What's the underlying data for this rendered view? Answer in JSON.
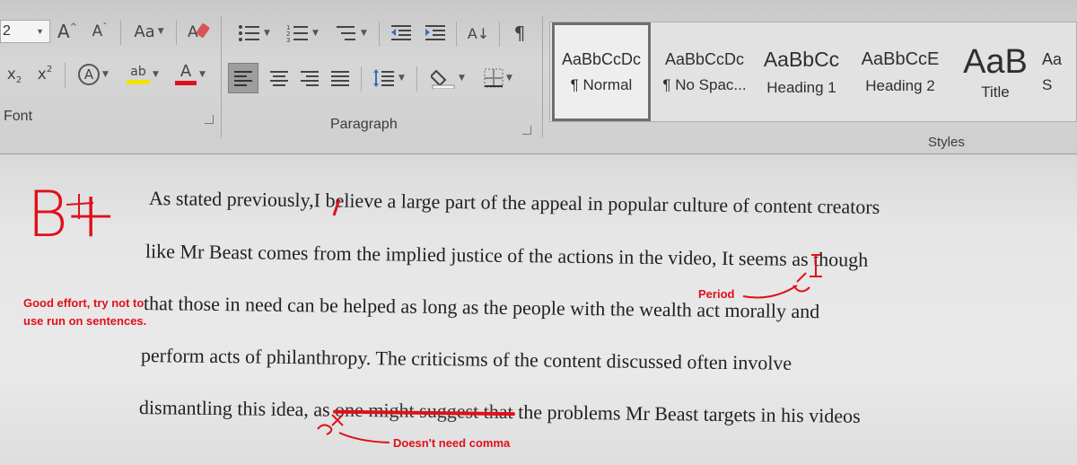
{
  "ribbon": {
    "font_size_value": "2",
    "groups": {
      "font_label": "Font",
      "paragraph_label": "Paragraph",
      "styles_label": "Styles"
    },
    "font_buttons": {
      "grow": "A",
      "shrink": "A",
      "change_case": "Aa",
      "subscript": "x",
      "superscript": "x",
      "text_effects": "A",
      "highlight": "ab",
      "font_color": "A"
    },
    "paragraph_buttons": {
      "sort": "A↓",
      "show_marks": "¶"
    },
    "styles": [
      {
        "preview": "AaBbCcDc",
        "name": "¶ Normal",
        "active": true
      },
      {
        "preview": "AaBbCcDc",
        "name": "¶ No Spac...",
        "active": false
      },
      {
        "preview": "AaBbCc",
        "name": "Heading 1",
        "active": false
      },
      {
        "preview": "AaBbCcE",
        "name": "Heading 2",
        "active": false
      },
      {
        "preview": "AaB",
        "name": "Title",
        "active": false
      },
      {
        "preview": "Aa",
        "name": "S",
        "active": false
      }
    ],
    "colors": {
      "highlight": "#f2e200",
      "font_color": "#e0101a"
    }
  },
  "document": {
    "lines": [
      "As stated previously,I believe a large part of the appeal in popular culture of content creators",
      "like Mr Beast comes from the implied justice of the actions in the video, It seems as though",
      "that those in need can be helped as long as the people with the wealth act morally and",
      "perform acts of philanthropy. The criticisms of the content discussed often involve"
    ],
    "line5_before": "dismantling this idea, as",
    "line5_struck": "one might suggest that",
    "line5_after": "the problems Mr Beast targets in his videos"
  },
  "annotations": {
    "grade": "B+",
    "feedback": "Good effort, try not to use run on sentences.",
    "period_note": "Period",
    "comma_note": "Doesn't need comma",
    "color": "#e0101a"
  }
}
